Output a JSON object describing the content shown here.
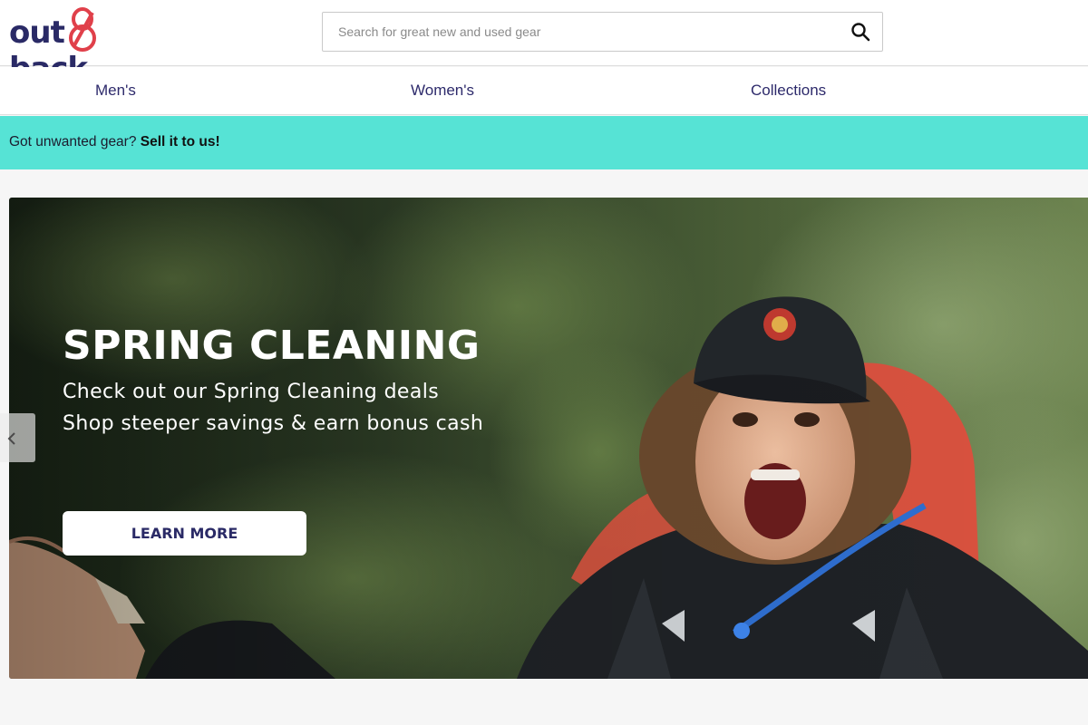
{
  "brand": {
    "logo_text_left": "out",
    "logo_text_right": "back",
    "logo_icon": "ampersand-8-icon",
    "colors": {
      "navy": "#2a2a66",
      "red": "#e0404a",
      "teal": "#56e3d5"
    }
  },
  "search": {
    "placeholder": "Search for great new and used gear",
    "value": "",
    "icon": "search-icon"
  },
  "nav": {
    "items": [
      {
        "label": "Men's"
      },
      {
        "label": "Women's"
      },
      {
        "label": "Collections"
      }
    ]
  },
  "promo": {
    "text": "Got unwanted gear? ",
    "link_label": "Sell it to us!"
  },
  "hero": {
    "title": "SPRING CLEANING",
    "subtitle_line1": "Check out our Spring Cleaning deals",
    "subtitle_line2": "Shop steeper savings & earn bonus cash",
    "cta_label": "LEARN MORE",
    "prev_icon": "chevron-left-icon"
  }
}
